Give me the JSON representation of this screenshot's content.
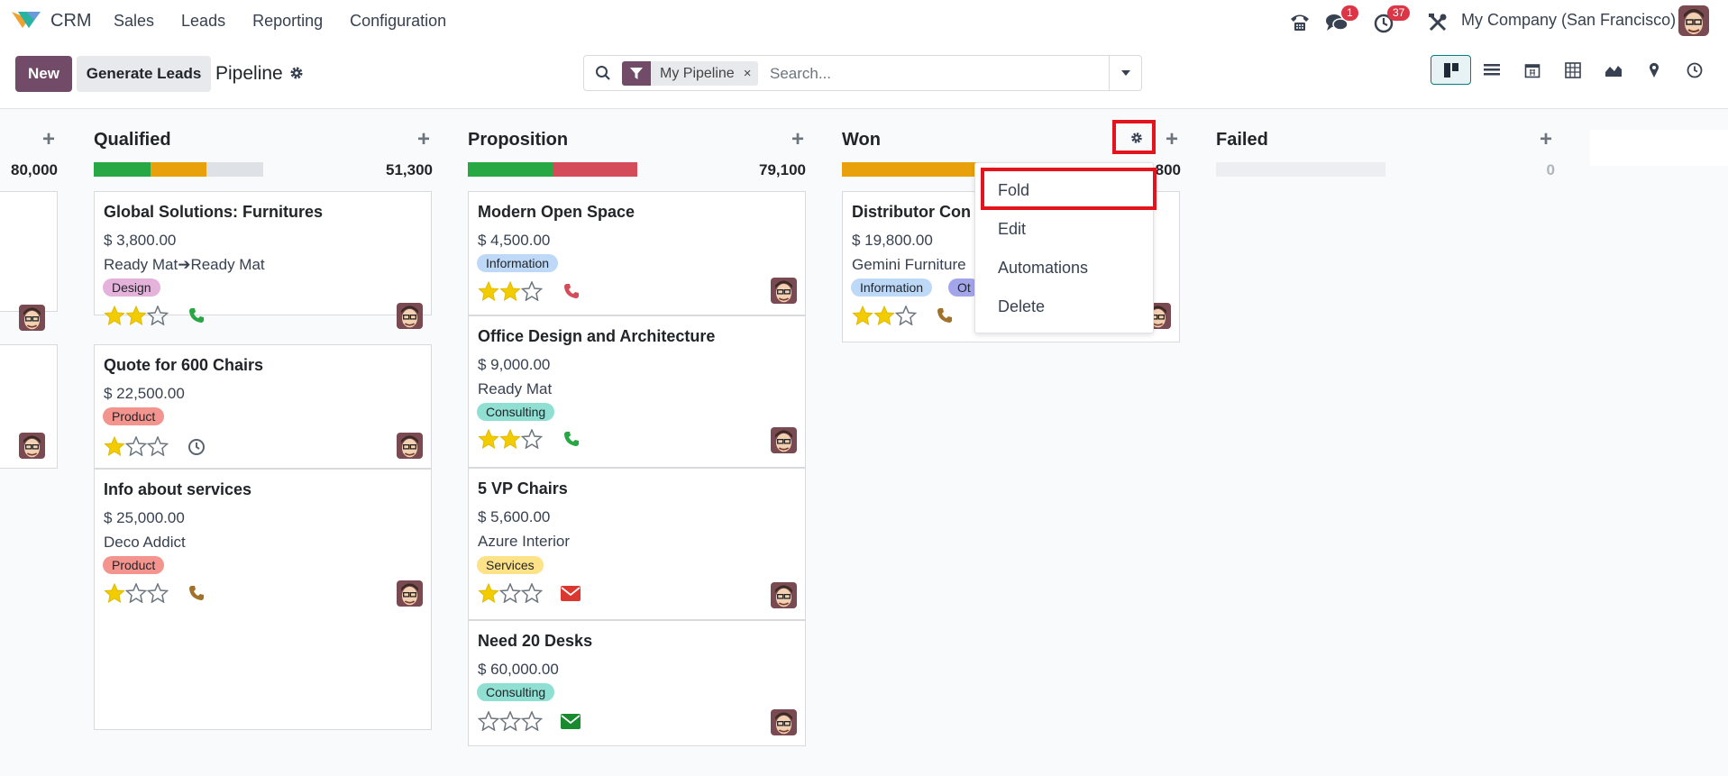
{
  "navbar": {
    "app_name": "CRM",
    "menu": [
      "Sales",
      "Leads",
      "Reporting",
      "Configuration"
    ],
    "messages_badge": "1",
    "activities_badge": "37",
    "company": "My Company (San Francisco)"
  },
  "control_panel": {
    "new_label": "New",
    "generate_label": "Generate Leads",
    "breadcrumb": "Pipeline",
    "facet_label": "My Pipeline",
    "facet_remove": "×",
    "search_placeholder": "Search..."
  },
  "columns": [
    {
      "name": "",
      "total": "80,000"
    },
    {
      "name": "Qualified",
      "total": "51,300"
    },
    {
      "name": "Proposition",
      "total": "79,100"
    },
    {
      "name": "Won",
      "total": "800"
    },
    {
      "name": "Failed",
      "total": "0"
    }
  ],
  "cards": {
    "q1": {
      "title": "Global Solutions: Furnitures",
      "amount": "$ 3,800.00",
      "customer": "Ready Mat➔Ready Mat",
      "tag": "Design",
      "stars": 2
    },
    "q2": {
      "title": "Quote for 600 Chairs",
      "amount": "$ 22,500.00",
      "tag": "Product",
      "stars": 1
    },
    "q3": {
      "title": "Info about services",
      "amount": "$ 25,000.00",
      "customer": "Deco Addict",
      "tag": "Product",
      "stars": 1
    },
    "p1": {
      "title": "Modern Open Space",
      "amount": "$ 4,500.00",
      "tag": "Information",
      "stars": 2
    },
    "p2": {
      "title": "Office Design and Architecture",
      "amount": "$ 9,000.00",
      "customer": "Ready Mat",
      "tag": "Consulting",
      "stars": 2
    },
    "p3": {
      "title": "5 VP Chairs",
      "amount": "$ 5,600.00",
      "customer": "Azure Interior",
      "tag": "Services",
      "stars": 1
    },
    "p4": {
      "title": "Need 20 Desks",
      "amount": "$ 60,000.00",
      "tag": "Consulting",
      "stars": 0
    },
    "w1": {
      "title": "Distributor Con",
      "amount": "$ 19,800.00",
      "customer": "Gemini Furniture",
      "tag": "Information",
      "tag2": "Ot",
      "stars": 2
    }
  },
  "dropdown": {
    "items": [
      "Fold",
      "Edit",
      "Automations",
      "Delete"
    ]
  },
  "colors": {
    "brand": "#714b67",
    "green": "#28a745",
    "orange": "#e8a10b",
    "red": "#d44c59",
    "highlight": "#e3141e"
  },
  "icons": [
    "phone-icon",
    "chat-icon",
    "clock-icon",
    "tools-icon",
    "gear-icon",
    "filter-icon",
    "search-icon",
    "kanban-view-icon",
    "list-view-icon",
    "calendar-view-icon",
    "pivot-view-icon",
    "graph-view-icon",
    "map-view-icon",
    "activity-view-icon",
    "star-icon",
    "envelope-icon"
  ]
}
